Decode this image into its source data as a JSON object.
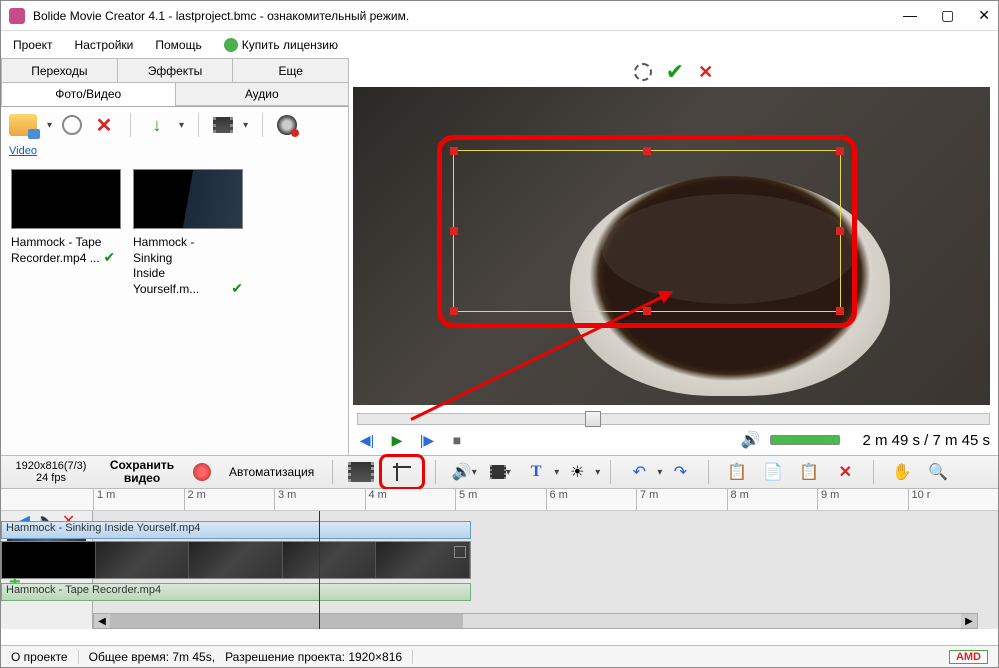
{
  "window": {
    "title": "Bolide Movie Creator 4.1 - lastproject.bmc  - ознакомительный режим."
  },
  "menu": {
    "project": "Проект",
    "settings": "Настройки",
    "help": "Помощь",
    "buy": "Купить лицензию"
  },
  "tabs": {
    "transitions": "Переходы",
    "effects": "Эффекты",
    "more": "Еще",
    "photo_video": "Фото/Видео",
    "audio": "Аудио"
  },
  "panel": {
    "video_label": "Video"
  },
  "clips": [
    {
      "name_line1": "Hammock - Tape",
      "name_line2": "Recorder.mp4 ..."
    },
    {
      "name_line1": "Hammock - Sinking",
      "name_line2": "Inside Yourself.m..."
    }
  ],
  "playback": {
    "time": "2 m 49 s   /  7 m 45 s"
  },
  "toolbar": {
    "dims_line1": "1920x816(7/3)",
    "dims_line2": "24 fps",
    "save_line1": "Сохранить",
    "save_line2": "видео",
    "automation": "Автоматизация",
    "text_tool": "T"
  },
  "ruler": [
    "1 m",
    "2 m",
    "3 m",
    "4 m",
    "5 m",
    "6 m",
    "7 m",
    "8 m",
    "9 m",
    "10 r"
  ],
  "timeline": {
    "clip_video": "Hammock - Sinking Inside Yourself.mp4",
    "clip_audio": "Hammock - Tape Recorder.mp4"
  },
  "status": {
    "about": "О проекте",
    "total_time": "Общее время: 7m 45s,",
    "resolution": "Разрешение проекта:    1920×816",
    "amd": "AMD"
  }
}
